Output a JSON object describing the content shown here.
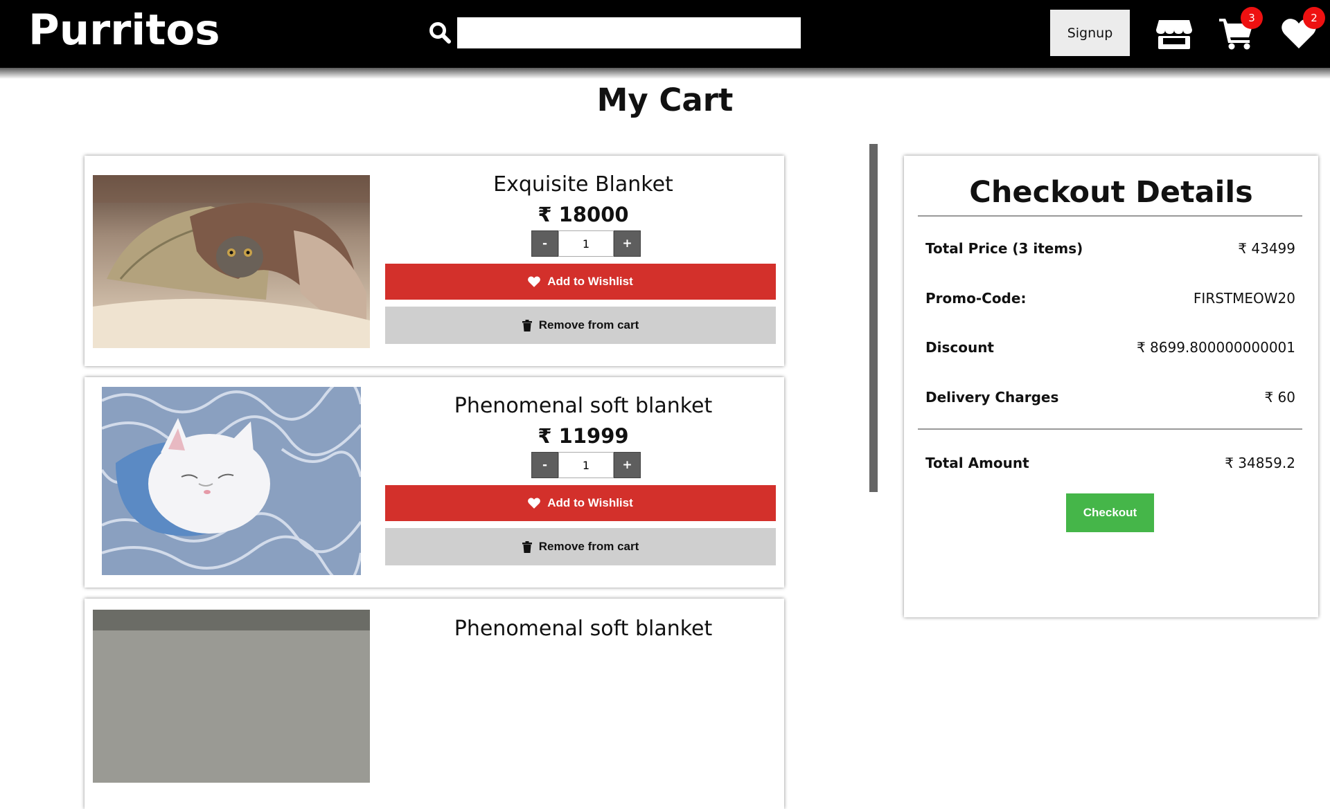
{
  "brand": "Purritos",
  "search": {
    "placeholder": ""
  },
  "nav": {
    "signup_label": "Signup",
    "cart_count": "3",
    "wishlist_count": "2"
  },
  "page_title": "My Cart",
  "currency_symbol": "₹",
  "cart_items": [
    {
      "name": "Exquisite Blanket",
      "price": "₹ 18000",
      "quantity": "1",
      "wishlist_label": "Add to Wishlist",
      "remove_label": "Remove from cart"
    },
    {
      "name": "Phenomenal soft blanket",
      "price": "₹ 11999",
      "quantity": "1",
      "wishlist_label": "Add to Wishlist",
      "remove_label": "Remove from cart"
    },
    {
      "name": "Phenomenal soft blanket"
    }
  ],
  "qty_controls": {
    "minus": "-",
    "plus": "+"
  },
  "checkout": {
    "title": "Checkout Details",
    "rows": [
      {
        "label": "Total Price (3 items)",
        "value": "₹ 43499"
      },
      {
        "label": "Promo-Code:",
        "value": "FIRSTMEOW20"
      },
      {
        "label": "Discount",
        "value": "₹ 8699.800000000001"
      },
      {
        "label": "Delivery Charges",
        "value": "₹ 60"
      }
    ],
    "total": {
      "label": "Total Amount",
      "value": "₹ 34859.2"
    },
    "button_label": "Checkout"
  },
  "colors": {
    "navbar": "#000000",
    "wishlist_button": "#d3302b",
    "remove_button": "#cfcfcf",
    "checkout_button": "#45b649",
    "badge": "#ee1111"
  }
}
